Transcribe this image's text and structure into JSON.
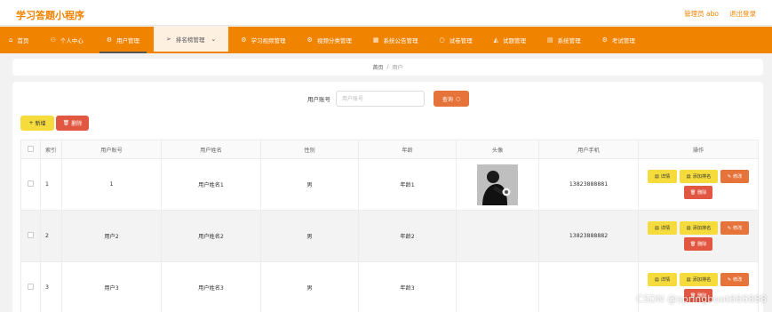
{
  "header": {
    "app_title": "学习答题小程序",
    "admin_label": "管理员 abo",
    "logout_label": "退出登录"
  },
  "nav": {
    "items": [
      {
        "label": "首页",
        "icon": "home-icon"
      },
      {
        "label": "个人中心",
        "icon": "user-icon"
      },
      {
        "label": "用户管理",
        "icon": "users-icon"
      },
      {
        "label": "排名榜管理",
        "icon": "send-icon"
      },
      {
        "label": "学习视频管理",
        "icon": "gear-icon"
      },
      {
        "label": "视频分类管理",
        "icon": "gear-icon"
      },
      {
        "label": "系统公告管理",
        "icon": "grid-icon"
      },
      {
        "label": "试卷管理",
        "icon": "circle-icon"
      },
      {
        "label": "试题管理",
        "icon": "stack-icon"
      },
      {
        "label": "系统管理",
        "icon": "doc-icon"
      },
      {
        "label": "考试管理",
        "icon": "gear-icon"
      }
    ]
  },
  "breadcrumb": {
    "home": "首页",
    "separator": "/",
    "current": "用户"
  },
  "search": {
    "label": "用户账号",
    "placeholder": "用户账号",
    "button_label": "查询"
  },
  "actions": {
    "add_label": "新增",
    "delete_label": "删除"
  },
  "table": {
    "columns": [
      "索引",
      "用户账号",
      "用户姓名",
      "性别",
      "年龄",
      "头像",
      "用户手机",
      "操作"
    ],
    "rows": [
      {
        "index": "1",
        "account": "1",
        "name": "用户姓名1",
        "gender": "男",
        "age": "年龄1",
        "has_avatar": true,
        "phone": "13823888881"
      },
      {
        "index": "2",
        "account": "用户2",
        "name": "用户姓名2",
        "gender": "男",
        "age": "年龄2",
        "has_avatar": false,
        "phone": "13823888882"
      },
      {
        "index": "3",
        "account": "用户3",
        "name": "用户姓名3",
        "gender": "男",
        "age": "年龄3",
        "has_avatar": false,
        "phone": ""
      }
    ],
    "ops": {
      "detail": "详情",
      "add_rank": "添加排名",
      "edit": "修改",
      "delete": "删除"
    }
  },
  "watermark": "CSDN @springboot666888",
  "colors": {
    "brand_orange": "#f08300",
    "search_button": "#e5733a",
    "add_yellow": "#f5dc3c",
    "delete_red": "#e25741"
  }
}
